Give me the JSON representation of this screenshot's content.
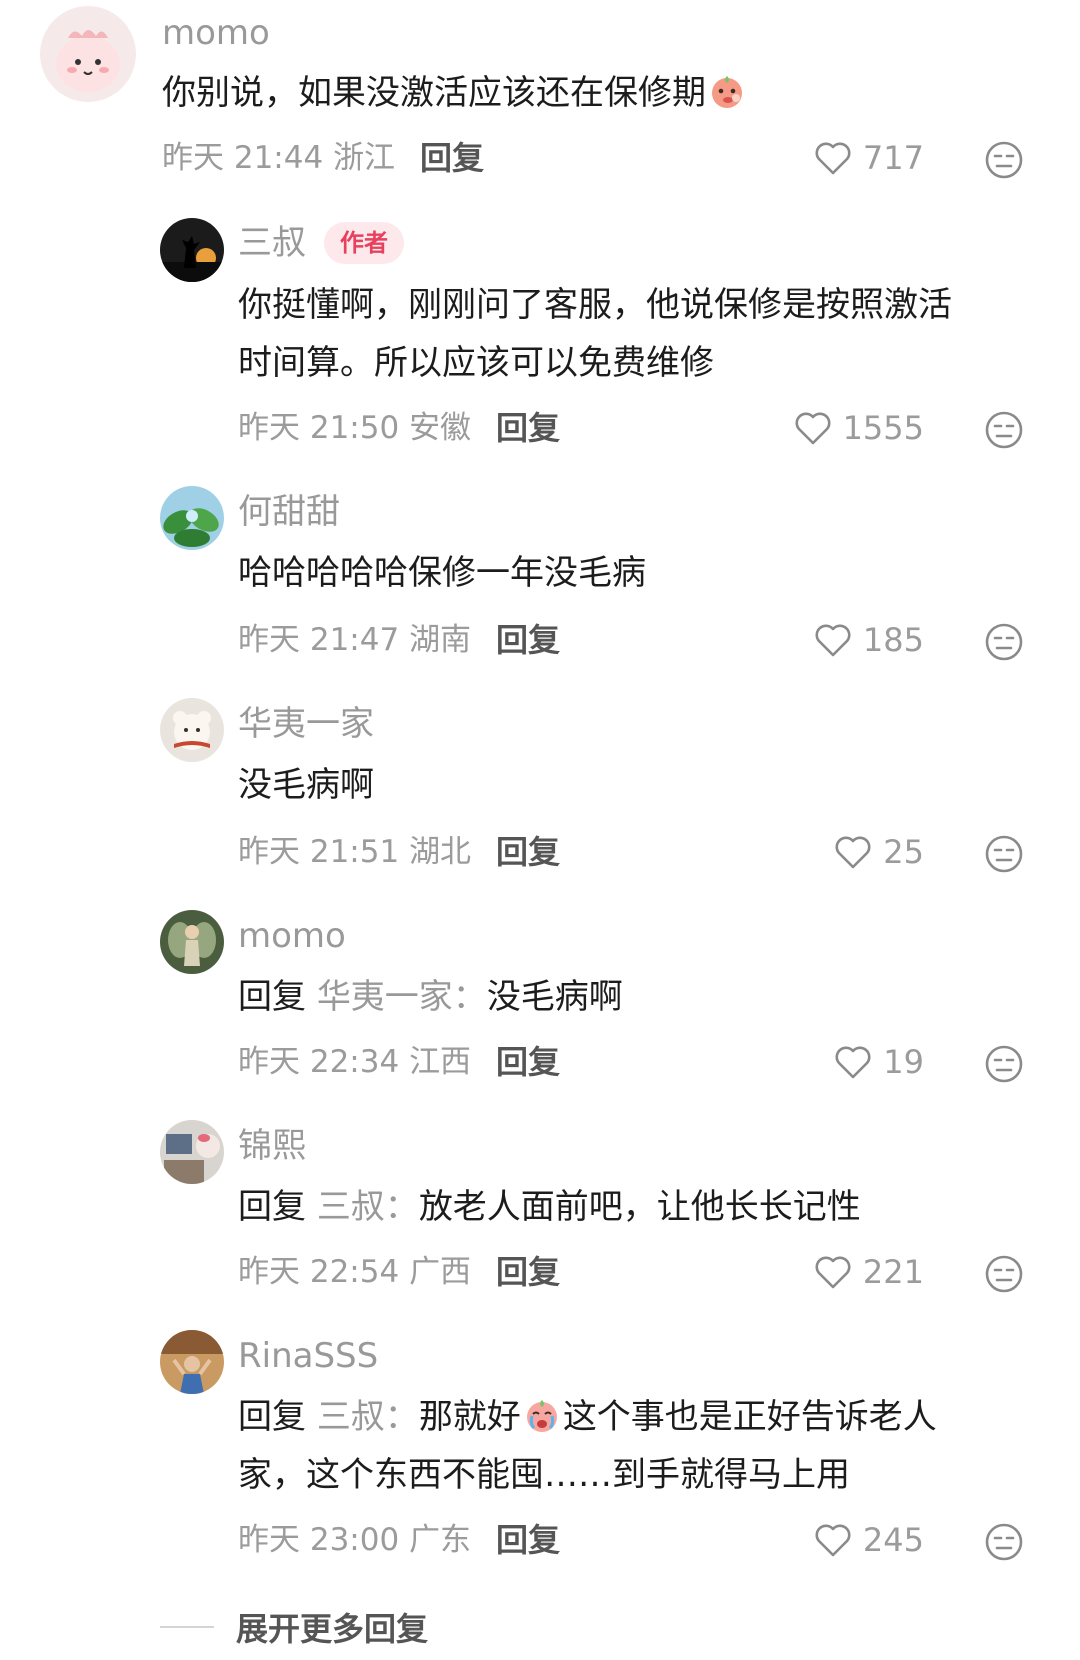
{
  "comments": [
    {
      "username": "momo",
      "content": "你别说，如果没激活应该还在保修期",
      "time": "昨天 21:44",
      "location": "浙江",
      "reply_label": "回复",
      "likes": "717",
      "avatar": "pink-cartoon-avatar"
    },
    {
      "username": "三叔",
      "badge": "作者",
      "content_lines": [
        "你挺懂啊，刚刚问了客服，他说保修是按照激活",
        "时间算。所以应该可以免费维修"
      ],
      "time": "昨天 21:50",
      "location": "安徽",
      "reply_label": "回复",
      "likes": "1555",
      "avatar": "silhouette-sunset-avatar"
    },
    {
      "username": "何甜甜",
      "content": "哈哈哈哈哈保修一年没毛病",
      "time": "昨天 21:47",
      "location": "湖南",
      "reply_label": "回复",
      "likes": "185",
      "avatar": "green-leaves-avatar"
    },
    {
      "username": "华夷一家",
      "content": "没毛病啊",
      "time": "昨天 21:51",
      "location": "湖北",
      "reply_label": "回复",
      "likes": "25",
      "avatar": "plush-toy-avatar"
    },
    {
      "username": "momo",
      "reply_prefix": "回复",
      "reply_target": "华夷一家：",
      "content": "没毛病啊",
      "time": "昨天 22:34",
      "location": "江西",
      "reply_label": "回复",
      "likes": "19",
      "avatar": "fairy-avatar"
    },
    {
      "username": "锦熙",
      "reply_prefix": "回复",
      "reply_target": "三叔：",
      "content": "放老人面前吧，让他长长记性",
      "time": "昨天 22:54",
      "location": "广西",
      "reply_label": "回复",
      "likes": "221",
      "avatar": "room-photo-avatar"
    },
    {
      "username": "RinaSSS",
      "reply_prefix": "回复",
      "reply_target": "三叔：",
      "content_a": "那就好",
      "content_b": "这个事也是正好告诉老人",
      "content_line2": "家，这个东西不能囤……到手就得马上用",
      "time": "昨天 23:00",
      "location": "广东",
      "reply_label": "回复",
      "likes": "245",
      "avatar": "photo-person-avatar"
    }
  ],
  "expand_more": "展开更多回复",
  "colors": {
    "author_badge_bg": "#fde8ec",
    "author_badge_text": "#e8415e",
    "meta_gray": "#9b9b9b",
    "text": "#1c1c1c"
  }
}
